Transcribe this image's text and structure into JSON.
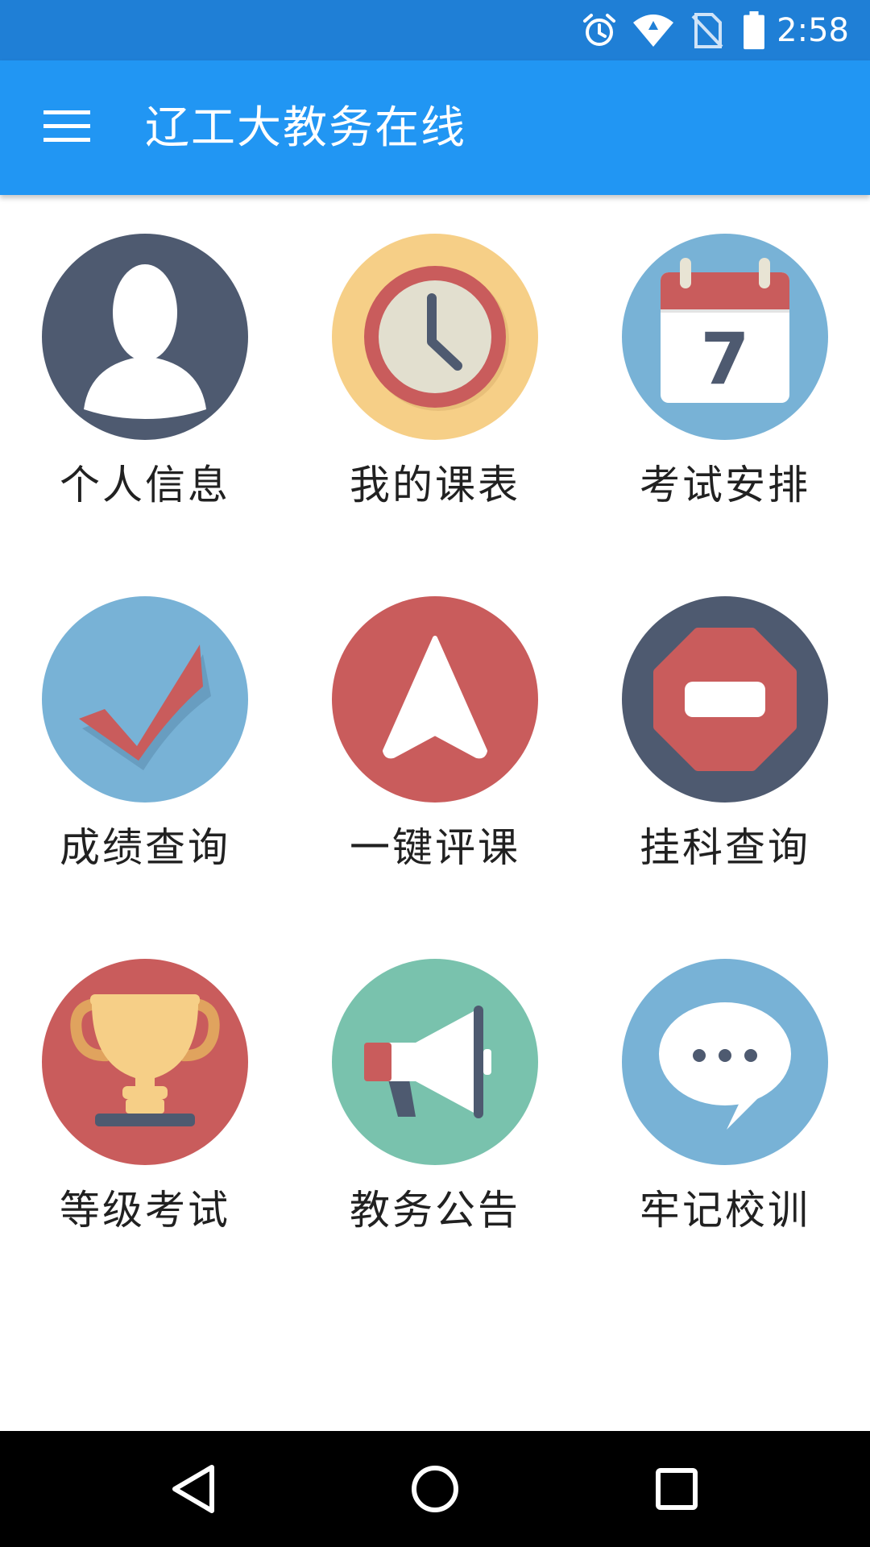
{
  "status_bar": {
    "time": "2:58",
    "icons": [
      "alarm-icon",
      "wifi-icon",
      "no-sim-icon",
      "battery-icon"
    ]
  },
  "app_bar": {
    "title": "辽工大教务在线",
    "menu_icon": "hamburger-menu-icon"
  },
  "grid": {
    "items": [
      {
        "label": "个人信息",
        "icon": "user-profile-icon"
      },
      {
        "label": "我的课表",
        "icon": "clock-icon"
      },
      {
        "label": "考试安排",
        "icon": "calendar-icon"
      },
      {
        "label": "成绩查询",
        "icon": "checkmark-icon"
      },
      {
        "label": "一键评课",
        "icon": "navigation-arrow-icon"
      },
      {
        "label": "挂科查询",
        "icon": "stop-sign-icon"
      },
      {
        "label": "等级考试",
        "icon": "trophy-icon"
      },
      {
        "label": "教务公告",
        "icon": "megaphone-icon"
      },
      {
        "label": "牢记校训",
        "icon": "chat-bubble-icon"
      }
    ]
  },
  "calendar_day": "7",
  "colors": {
    "status_bar": "#1f7fd6",
    "app_bar": "#2196f3",
    "navy": "#4e5a70",
    "yellow": "#f6cf87",
    "blue": "#78b2d6",
    "red": "#c95c5c",
    "teal": "#79c2ad"
  },
  "nav_bar": {
    "icons": [
      "back-icon",
      "home-icon",
      "recents-icon"
    ]
  }
}
